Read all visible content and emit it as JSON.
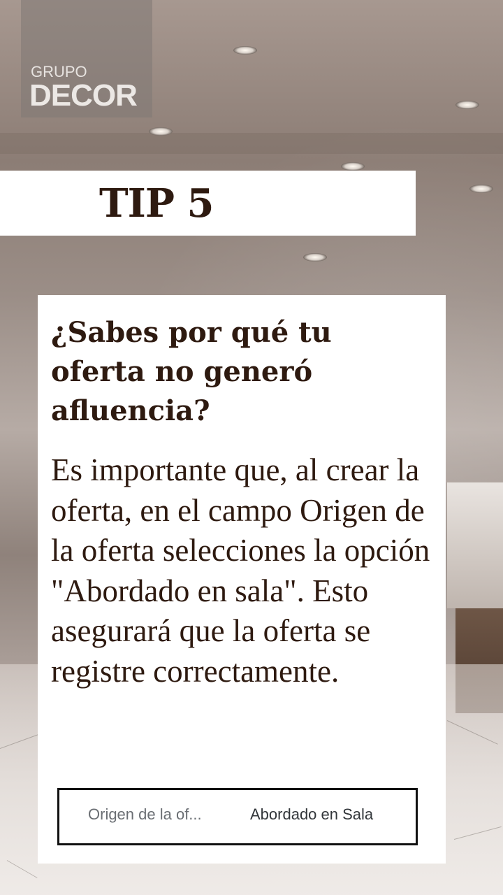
{
  "logo": {
    "top_text": "GRUPO",
    "main_text": "DECOR"
  },
  "tip": {
    "label": "TIP 5"
  },
  "card": {
    "title": "¿Sabes por qué tu oferta no generó afluencia?",
    "body": "Es importante que, al crear la oferta, en el campo Origen de la oferta selecciones la opción \"Abordado en sala\". Esto asegurará que la oferta se registre correctamente.",
    "field": {
      "label": "Origen de la of...",
      "value": "Abordado en Sala"
    }
  },
  "colors": {
    "text_dark_brown": "#2e1a10",
    "card_background": "#ffffff",
    "field_border": "#111111"
  }
}
